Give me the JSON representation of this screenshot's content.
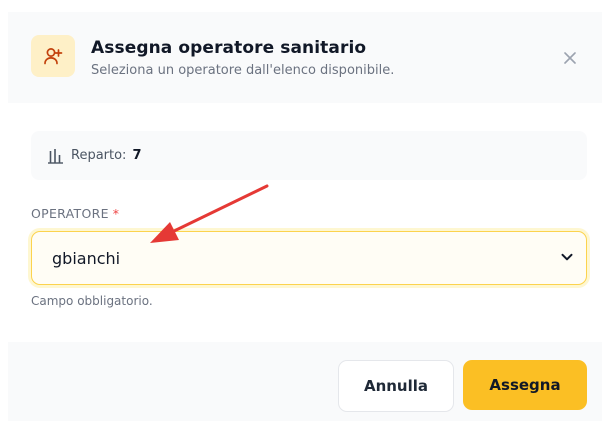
{
  "dialog": {
    "title": "Assegna operatore sanitario",
    "subtitle": "Seleziona un operatore dall'elenco disponibile.",
    "icon": "user-plus-icon",
    "close_icon": "close-icon"
  },
  "info": {
    "icon": "bar-chart-icon",
    "label": "Reparto:",
    "value": "7"
  },
  "field": {
    "label": "OPERATORE",
    "required_mark": "*",
    "selected_value": "gbianchi",
    "hint": "Campo obbligatorio."
  },
  "footer": {
    "cancel_label": "Annulla",
    "assign_label": "Assegna"
  },
  "colors": {
    "accent": "#fbbf24",
    "accent_soft": "#fef0c7",
    "required": "#ef4444",
    "annotation_arrow": "#e53935"
  }
}
